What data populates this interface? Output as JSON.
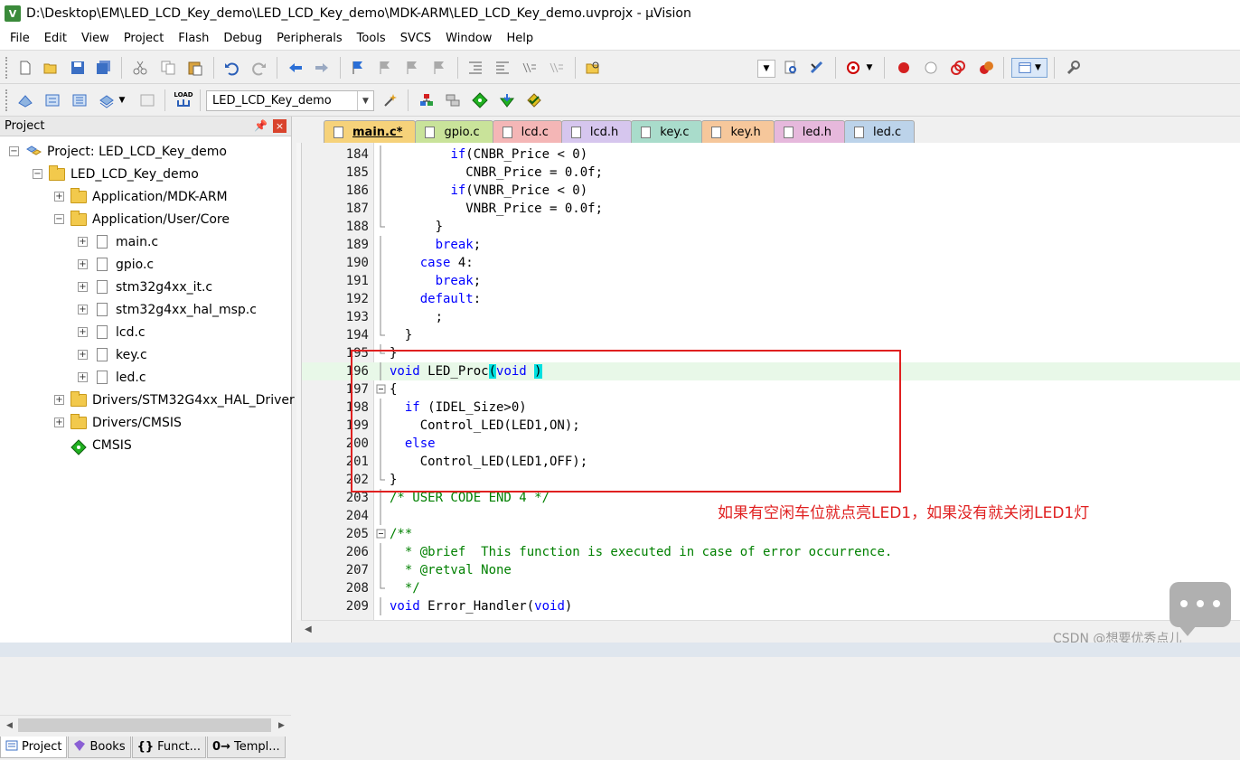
{
  "window": {
    "app_icon": "V",
    "title": "D:\\Desktop\\EM\\LED_LCD_Key_demo\\LED_LCD_Key_demo\\MDK-ARM\\LED_LCD_Key_demo.uvprojx - µVision"
  },
  "menu": [
    "File",
    "Edit",
    "View",
    "Project",
    "Flash",
    "Debug",
    "Peripherals",
    "Tools",
    "SVCS",
    "Window",
    "Help"
  ],
  "toolbar2": {
    "target": "LED_LCD_Key_demo",
    "load_label": "LOAD"
  },
  "project_panel": {
    "title": "Project",
    "pin": "ᵖ",
    "close": "×",
    "tree": [
      {
        "label": "Project: LED_LCD_Key_demo",
        "level": 0,
        "kind": "project",
        "expanded": true
      },
      {
        "label": "LED_LCD_Key_demo",
        "level": 1,
        "kind": "target",
        "expanded": true
      },
      {
        "label": "Application/MDK-ARM",
        "level": 2,
        "kind": "folder",
        "expanded": false
      },
      {
        "label": "Application/User/Core",
        "level": 2,
        "kind": "folder",
        "expanded": true
      },
      {
        "label": "main.c",
        "level": 3,
        "kind": "file",
        "expanded": false
      },
      {
        "label": "gpio.c",
        "level": 3,
        "kind": "file",
        "expanded": false
      },
      {
        "label": "stm32g4xx_it.c",
        "level": 3,
        "kind": "file",
        "expanded": false
      },
      {
        "label": "stm32g4xx_hal_msp.c",
        "level": 3,
        "kind": "file",
        "expanded": false
      },
      {
        "label": "lcd.c",
        "level": 3,
        "kind": "file",
        "expanded": false
      },
      {
        "label": "key.c",
        "level": 3,
        "kind": "file",
        "expanded": false
      },
      {
        "label": "led.c",
        "level": 3,
        "kind": "file",
        "expanded": false
      },
      {
        "label": "Drivers/STM32G4xx_HAL_Driver",
        "level": 2,
        "kind": "folder",
        "expanded": false
      },
      {
        "label": "Drivers/CMSIS",
        "level": 2,
        "kind": "folder",
        "expanded": false
      },
      {
        "label": "CMSIS",
        "level": 2,
        "kind": "component",
        "expanded": false
      }
    ],
    "bottom_tabs": [
      {
        "icon": "",
        "label": "Project"
      },
      {
        "icon": "",
        "label": "Books"
      },
      {
        "icon": "{}",
        "label": "Funct..."
      },
      {
        "icon": "0→",
        "label": "Templ..."
      }
    ]
  },
  "editor_tabs": [
    {
      "label": "main.c*",
      "color": "#f6d27a",
      "active": true
    },
    {
      "label": "gpio.c",
      "color": "#c9e39a"
    },
    {
      "label": "lcd.c",
      "color": "#f4b6b6"
    },
    {
      "label": "lcd.h",
      "color": "#d6c6ee"
    },
    {
      "label": "key.c",
      "color": "#a9dccb"
    },
    {
      "label": "key.h",
      "color": "#f6c79b"
    },
    {
      "label": "led.h",
      "color": "#e6b8dc"
    },
    {
      "label": "led.c",
      "color": "#bcd3ea"
    }
  ],
  "code_lines": [
    {
      "n": "184",
      "t": "        if(CNBR_Price < 0)"
    },
    {
      "n": "185",
      "t": "          CNBR_Price = 0.0f;"
    },
    {
      "n": "186",
      "t": "        if(VNBR_Price < 0)"
    },
    {
      "n": "187",
      "t": "          VNBR_Price = 0.0f;"
    },
    {
      "n": "188",
      "t": "      }"
    },
    {
      "n": "189",
      "t": "      break;"
    },
    {
      "n": "190",
      "t": "    case 4:"
    },
    {
      "n": "191",
      "t": "      break;"
    },
    {
      "n": "192",
      "t": "    default:"
    },
    {
      "n": "193",
      "t": "      ;"
    },
    {
      "n": "194",
      "t": "  }"
    },
    {
      "n": "195",
      "t": "}"
    },
    {
      "n": "196",
      "t": "void LED_Proc(void )"
    },
    {
      "n": "197",
      "t": "{"
    },
    {
      "n": "198",
      "t": "  if (IDEL_Size>0)"
    },
    {
      "n": "199",
      "t": "    Control_LED(LED1,ON);"
    },
    {
      "n": "200",
      "t": "  else"
    },
    {
      "n": "201",
      "t": "    Control_LED(LED1,OFF);"
    },
    {
      "n": "202",
      "t": "}"
    },
    {
      "n": "203",
      "t": "/* USER CODE END 4 */"
    },
    {
      "n": "204",
      "t": ""
    },
    {
      "n": "205",
      "t": "/**"
    },
    {
      "n": "206",
      "t": "  * @brief  This function is executed in case of error occurrence."
    },
    {
      "n": "207",
      "t": "  * @retval None"
    },
    {
      "n": "208",
      "t": "  */"
    },
    {
      "n": "209",
      "t": "void Error_Handler(void)"
    }
  ],
  "annotation": "如果有空闲车位就点亮LED1，如果没有就关闭LED1灯",
  "watermark": "CSDN @想要优秀点儿"
}
